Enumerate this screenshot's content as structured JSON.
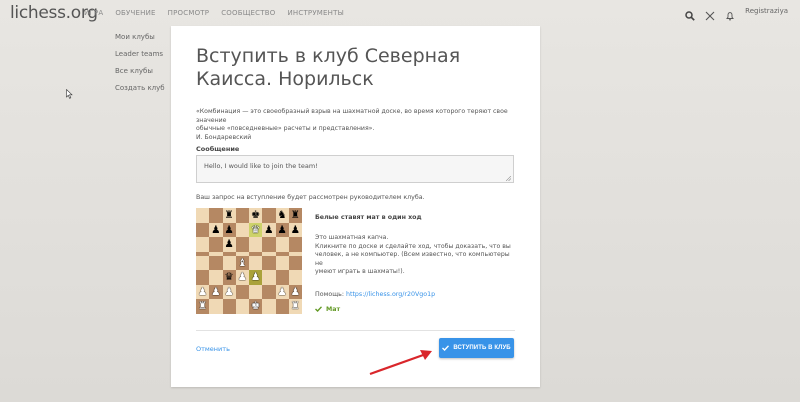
{
  "header": {
    "logo": "lichess.org",
    "nav": [
      "ИГРА",
      "ОБУЧЕНИЕ",
      "ПРОСМОТР",
      "СООБЩЕСТВО",
      "ИНСТРУМЕНТЫ"
    ],
    "signin": "Registraziya"
  },
  "sidebar": {
    "items": [
      {
        "label": "Мои клубы"
      },
      {
        "label": "Leader teams"
      },
      {
        "label": "Все клубы"
      },
      {
        "label": "Создать клуб"
      }
    ]
  },
  "card": {
    "title": "Вступить в клуб Северная Каисса. Норильск",
    "quote_line1": "«Комбинация — это своеобразный взрыв на шахматной доске, во время которого теряют свое значение",
    "quote_line2": "обычные «повседневные» расчеты и представления».",
    "quote_author": "И. Бондаревский",
    "message_label": "Сообщение",
    "message_value": "Hello, I would like to join the team!",
    "review_note": "Ваш запрос на вступление будет рассмотрен руководителем клуба.",
    "captcha": {
      "title": "Белые ставят мат в один ход",
      "line1": "Это шахматная капча.",
      "line2": "Кликните по доске и сделайте ход, чтобы доказать, что вы",
      "line3": "человек, а не компьютер. (Всем известно, что компьютеры не",
      "line4": "умеют играть в шахматы!).",
      "help_label": "Помощь:",
      "help_link": "https://lichess.org/r20Vgo1p",
      "result": "Мат"
    },
    "board": [
      [
        "",
        "",
        "bR",
        "",
        "bK",
        "",
        "bN",
        "bR"
      ],
      [
        "",
        "bP",
        "bP",
        "",
        "wQ",
        "bP",
        "bP",
        "bP"
      ],
      [
        "",
        "",
        "bP",
        "",
        "",
        "",
        "",
        ""
      ],
      [
        "",
        "",
        "",
        "",
        "",
        "",
        "",
        ""
      ],
      [
        "",
        "",
        "",
        "wB",
        "",
        "",
        "",
        ""
      ],
      [
        "",
        "",
        "bQ",
        "wP",
        "wP",
        "",
        "",
        ""
      ],
      [
        "wP",
        "wP",
        "wP",
        "",
        "",
        "",
        "wP",
        "wP"
      ],
      [
        "wR",
        "",
        "",
        "",
        "wK",
        "",
        "",
        "wR"
      ]
    ],
    "cancel": "Отменить",
    "join_button": "ВСТУПИТЬ В КЛУБ"
  },
  "colors": {
    "accent": "#3893e8",
    "success": "#629924",
    "arrow": "#d9262b",
    "board_light": "#f0d9b5",
    "board_dark": "#b58863"
  }
}
